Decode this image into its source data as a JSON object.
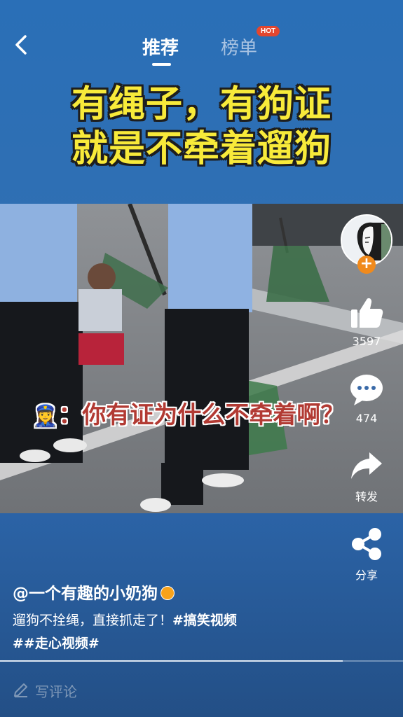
{
  "header": {
    "tabs": [
      {
        "label": "推荐",
        "active": true
      },
      {
        "label": "榜单",
        "badge": "HOT"
      }
    ]
  },
  "caption": {
    "line1": "有绳子，有狗证",
    "line2": "就是不牵着遛狗"
  },
  "video": {
    "subtitle_emoji": "👮‍♀️",
    "subtitle_text": "：你有证为什么不牵着啊？"
  },
  "actions": {
    "like_count": "3597",
    "comment_count": "474",
    "forward_label": "转发",
    "share_label": "分享"
  },
  "post": {
    "author": "@一个有趣的小奶狗",
    "description": "遛狗不拴绳，直接抓走了！",
    "tag1": "#搞笑视频",
    "tag2": "##走心视频#",
    "progress": 0.85
  },
  "comment_input": {
    "placeholder": "写评论"
  },
  "colors": {
    "background": "#2b66ac",
    "caption_yellow": "#f8ea3a",
    "subtitle_red": "#b23a33",
    "hot_badge": "#e3462e",
    "follow_orange": "#f08a1c"
  },
  "icons": [
    "back-arrow-icon",
    "thumbs-up-icon",
    "comment-bubble-icon",
    "forward-arrow-icon",
    "share-nodes-icon",
    "pencil-icon",
    "verified-badge-icon",
    "plus-icon"
  ]
}
